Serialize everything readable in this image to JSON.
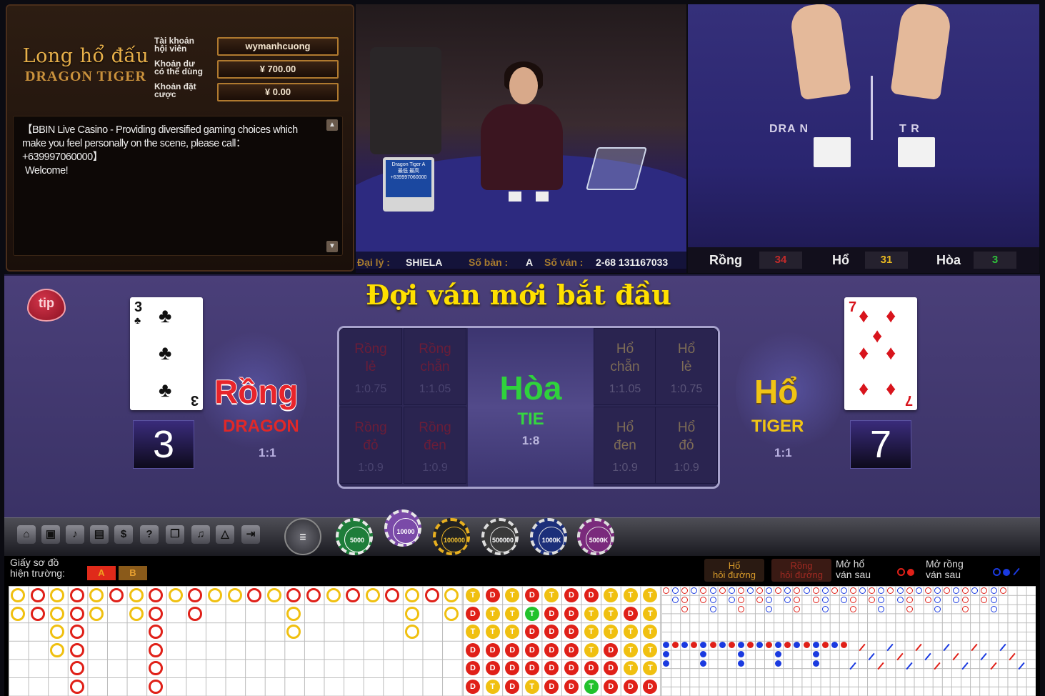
{
  "game": {
    "title_vi": "Long hổ đấu",
    "title_en": "DRAGON TIGER"
  },
  "account": {
    "member_label": "Tài khoản\nhội viên",
    "member_value": "wymanhcuong",
    "balance_label": "Khoản dư\ncó thể dùng",
    "balance_value": "¥ 700.00",
    "bet_label": "Khoản đặt\ncược",
    "bet_value": "¥ 0.00"
  },
  "message": {
    "text": "【BBIN Live Casino - Providing diversified gaming choices which make you feel personally on the scene, please call：+639997060000】",
    "welcome": "Welcome!"
  },
  "dealer_bar": {
    "dealer_label": "Đại lý :",
    "dealer_value": "SHIELA",
    "table_label": "Số bàn :",
    "table_value": "A",
    "round_label": "Số ván :",
    "round_value": "2-68 131167033"
  },
  "monitor_text": "Dragon Tiger A\n最低 最高\n+639997060000",
  "video2_labels": {
    "dragon": "DRA  N",
    "tiger": "T    R"
  },
  "scores": {
    "dragon_label": "Rồng",
    "dragon_value": "34",
    "tiger_label": "Hổ",
    "tiger_value": "31",
    "tie_label": "Hòa",
    "tie_value": "3"
  },
  "status_message": "Đợi ván mới bắt đầu",
  "tip_label": "tip",
  "dragon": {
    "card_rank": "3",
    "card_suit": "♣",
    "score": "3",
    "name": "Rồng",
    "sub": "DRAGON",
    "odds": "1:1"
  },
  "tiger": {
    "card_rank": "7",
    "card_suit": "♦",
    "score": "7",
    "name": "Hổ",
    "sub": "TIGER",
    "odds": "1:1"
  },
  "bets": {
    "dragon_odd": {
      "label": "Rồng\nlẻ",
      "odds": "1:0.75"
    },
    "dragon_even": {
      "label": "Rồng\nchẵn",
      "odds": "1:1.05"
    },
    "dragon_red": {
      "label": "Rồng\nđỏ",
      "odds": "1:0.9"
    },
    "dragon_black": {
      "label": "Rồng\nđen",
      "odds": "1:0.9"
    },
    "tie": {
      "label": "Hòa",
      "sub": "TIE",
      "odds": "1:8"
    },
    "tiger_even": {
      "label": "Hổ\nchẵn",
      "odds": "1:1.05"
    },
    "tiger_odd": {
      "label": "Hổ\nlẻ",
      "odds": "1:0.75"
    },
    "tiger_black": {
      "label": "Hổ\nđen",
      "odds": "1:0.9"
    },
    "tiger_red": {
      "label": "Hổ\nđỏ",
      "odds": "1:0.9"
    }
  },
  "toolbar_icons": [
    "home-icon",
    "video-icon",
    "sound-icon",
    "history-icon",
    "money-icon",
    "help-icon",
    "copy-icon",
    "music-icon",
    "warning-icon",
    "exit-icon"
  ],
  "chips": [
    {
      "label": "",
      "color": "#505058"
    },
    {
      "label": "5000",
      "color": "#1e7d3a"
    },
    {
      "label": "10000",
      "color": "#7a4aa8"
    },
    {
      "label": "100000",
      "color": "#222222"
    },
    {
      "label": "500000",
      "color": "#3a3a3a"
    },
    {
      "label": "1000K",
      "color": "#1c2f7a"
    },
    {
      "label": "5000K",
      "color": "#7a2a7c"
    }
  ],
  "roadmap": {
    "label": "Giấy sơ đồ\nhiện trường:",
    "tab_a": "A",
    "tab_b": "B",
    "tiger_ask": "Hổ\nhỏi đường",
    "dragon_ask": "Rồng\nhỏi đường",
    "next_tiger": "Mở hổ\nván sau",
    "next_dragon": "Mở rồng\nván sau",
    "bead_tiger": "T",
    "bead_dragon": "D",
    "bead_tie": "T"
  },
  "colors": {
    "dragon": "#e02018",
    "tiger": "#f0c010",
    "tie": "#22c22c",
    "accent": "#e8b04a"
  }
}
